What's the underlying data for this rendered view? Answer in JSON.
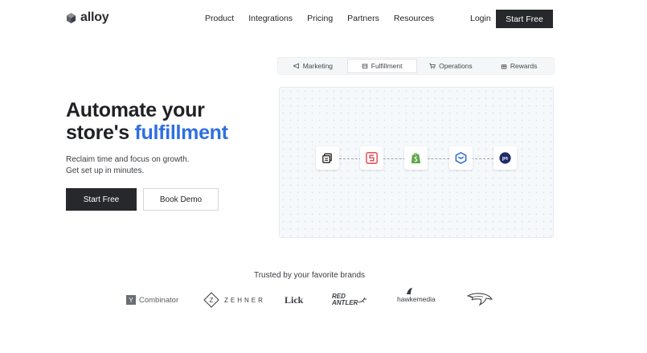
{
  "brand": {
    "name": "alloy"
  },
  "nav": {
    "items": [
      "Product",
      "Integrations",
      "Pricing",
      "Partners",
      "Resources"
    ],
    "login": "Login",
    "cta": "Start Free"
  },
  "hero": {
    "title_line1": "Automate your",
    "title_line2_prefix": "store's ",
    "title_line2_accent": "fulfillment",
    "subtitle_line1": "Reclaim time and focus on growth.",
    "subtitle_line2": "Get set up in minutes.",
    "primary_cta": "Start Free",
    "secondary_cta": "Book Demo",
    "accent_color": "#2f6fe0"
  },
  "tabs": {
    "items": [
      {
        "label": "Marketing",
        "icon": "megaphone-icon"
      },
      {
        "label": "Fulfillment",
        "icon": "box-icon",
        "active": true
      },
      {
        "label": "Operations",
        "icon": "cart-icon"
      },
      {
        "label": "Rewards",
        "icon": "gift-icon"
      }
    ]
  },
  "flow": {
    "nodes": [
      "app-window-icon",
      "shipstation-logo-icon",
      "shopify-logo-icon",
      "shipbob-logo-icon",
      "postscript-logo-icon"
    ],
    "postscript_label": "ps"
  },
  "brands": {
    "title": "Trusted by your favorite brands",
    "logos": [
      {
        "name": "Combinator",
        "mark": "Y"
      },
      {
        "name": "ZEHNER",
        "mark": "Z"
      },
      {
        "name": "Lick"
      },
      {
        "name_line1": "RED",
        "name_line2": "ANTLER"
      },
      {
        "name": "hawkemedia"
      },
      {
        "name": "broncos-logo"
      }
    ]
  }
}
